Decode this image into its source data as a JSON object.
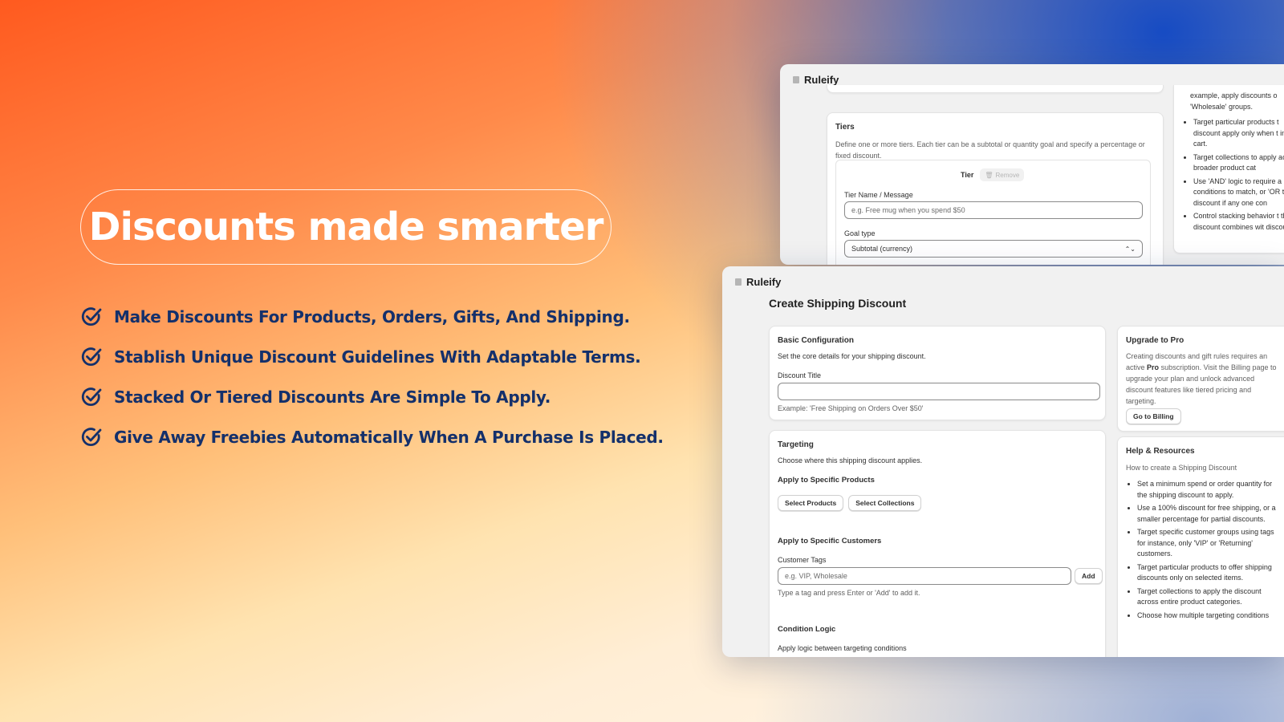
{
  "hero": {
    "headline": "Discounts made smarter",
    "features": [
      "Make Discounts For Products, Orders, Gifts, And Shipping.",
      "Stablish Unique Discount Guidelines With Adaptable Terms.",
      "Stacked Or Tiered Discounts Are Simple To Apply.",
      "Give Away Freebies Automatically When A Purchase Is Placed."
    ]
  },
  "back_window": {
    "app_name": "Ruleify",
    "tiers": {
      "title": "Tiers",
      "description": "Define one or more tiers. Each tier can be a subtotal or quantity goal and specify a percentage or fixed discount.",
      "tier_label": "Tier",
      "remove_label": "Remove",
      "name_label": "Tier Name / Message",
      "name_placeholder": "e.g. Free mug when you spend $50",
      "goal_label": "Goal type",
      "goal_value": "Subtotal (currency)"
    },
    "side_bullets_top": "example, apply discounts o 'Wholesale' groups.",
    "side_bullets": [
      "Target particular products t discount apply only when t in the cart.",
      "Target collections to apply across broader product cat",
      "Use 'AND' logic to require a conditions to match, or 'OR the discount if any one con",
      "Control stacking behavior t this discount combines wit discounts."
    ]
  },
  "front_window": {
    "app_name": "Ruleify",
    "page_title": "Create Shipping Discount",
    "basic": {
      "title": "Basic Configuration",
      "description": "Set the core details for your shipping discount.",
      "field_label": "Discount Title",
      "field_value": "",
      "help": "Example: 'Free Shipping on Orders Over $50'"
    },
    "targeting": {
      "title": "Targeting",
      "description": "Choose where this shipping discount applies.",
      "products_heading": "Apply to Specific Products",
      "select_products": "Select Products",
      "select_collections": "Select Collections",
      "customers_heading": "Apply to Specific Customers",
      "tags_label": "Customer Tags",
      "tags_placeholder": "e.g. VIP, Wholesale",
      "add_label": "Add",
      "tags_help": "Type a tag and press Enter or 'Add' to add it.",
      "logic_heading": "Condition Logic",
      "logic_description": "Apply logic between targeting conditions"
    },
    "upgrade": {
      "title": "Upgrade to Pro",
      "text_before": "Creating discounts and gift rules requires an active",
      "text_bold": "Pro",
      "text_after": "subscription. Visit the Billing page to upgrade your plan and unlock advanced discount features like tiered pricing and targeting.",
      "button": "Go to Billing"
    },
    "help": {
      "title": "Help & Resources",
      "subtitle": "How to create a Shipping Discount",
      "bullets": [
        "Set a minimum spend or order quantity for the shipping discount to apply.",
        "Use a 100% discount for free shipping, or a smaller percentage for partial discounts.",
        "Target specific customer groups using tags for instance, only 'VIP' or 'Returning' customers.",
        "Target particular products to offer shipping discounts only on selected items.",
        "Target collections to apply the discount across entire product categories.",
        "Choose how multiple targeting conditions"
      ]
    }
  },
  "colors": {
    "headline": "#ffffff",
    "feature_text": "#14306b",
    "check": "#14306b"
  }
}
